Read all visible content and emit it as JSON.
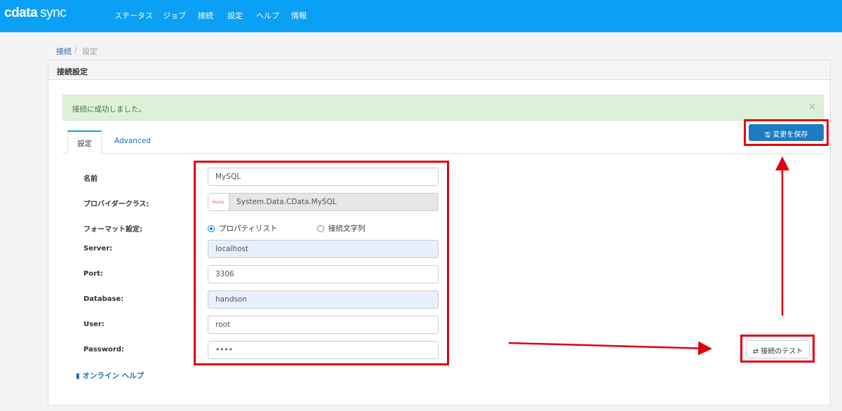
{
  "nav": {
    "logo_main": "cdata",
    "logo_sub": "sync",
    "items": [
      "ステータス",
      "ジョブ",
      "接続",
      "設定",
      "ヘルプ",
      "情報"
    ]
  },
  "breadcrumb": {
    "parent": "接続",
    "separator": "/",
    "current": "設定"
  },
  "panel": {
    "title": "接続設定"
  },
  "alert": {
    "message": "接続に成功しました。",
    "close": "×"
  },
  "tabs": [
    "設定",
    "Advanced"
  ],
  "buttons": {
    "save": "変更を保存",
    "test": "接続のテスト"
  },
  "form": {
    "name_label": "名前",
    "name_value": "MySQL",
    "provider_label": "プロバイダークラス:",
    "provider_value": "System.Data.CData.MySQL",
    "provider_icon_text": "MySQL",
    "format_label": "フォーマット設定:",
    "format_options": [
      "プロパティリスト",
      "接続文字列"
    ],
    "format_selected": "プロパティリスト",
    "server_label": "Server:",
    "server_value": "localhost",
    "port_label": "Port:",
    "port_value": "3306",
    "database_label": "Database:",
    "database_value": "handson",
    "user_label": "User:",
    "user_value": "root",
    "password_label": "Password:",
    "password_value": "••••"
  },
  "help_link": "オンライン ヘルプ",
  "colors": {
    "nav": "#0aa0f5",
    "primary": "#1d7cc1",
    "annotation": "#e00012",
    "alert_bg": "#dff0d8"
  }
}
